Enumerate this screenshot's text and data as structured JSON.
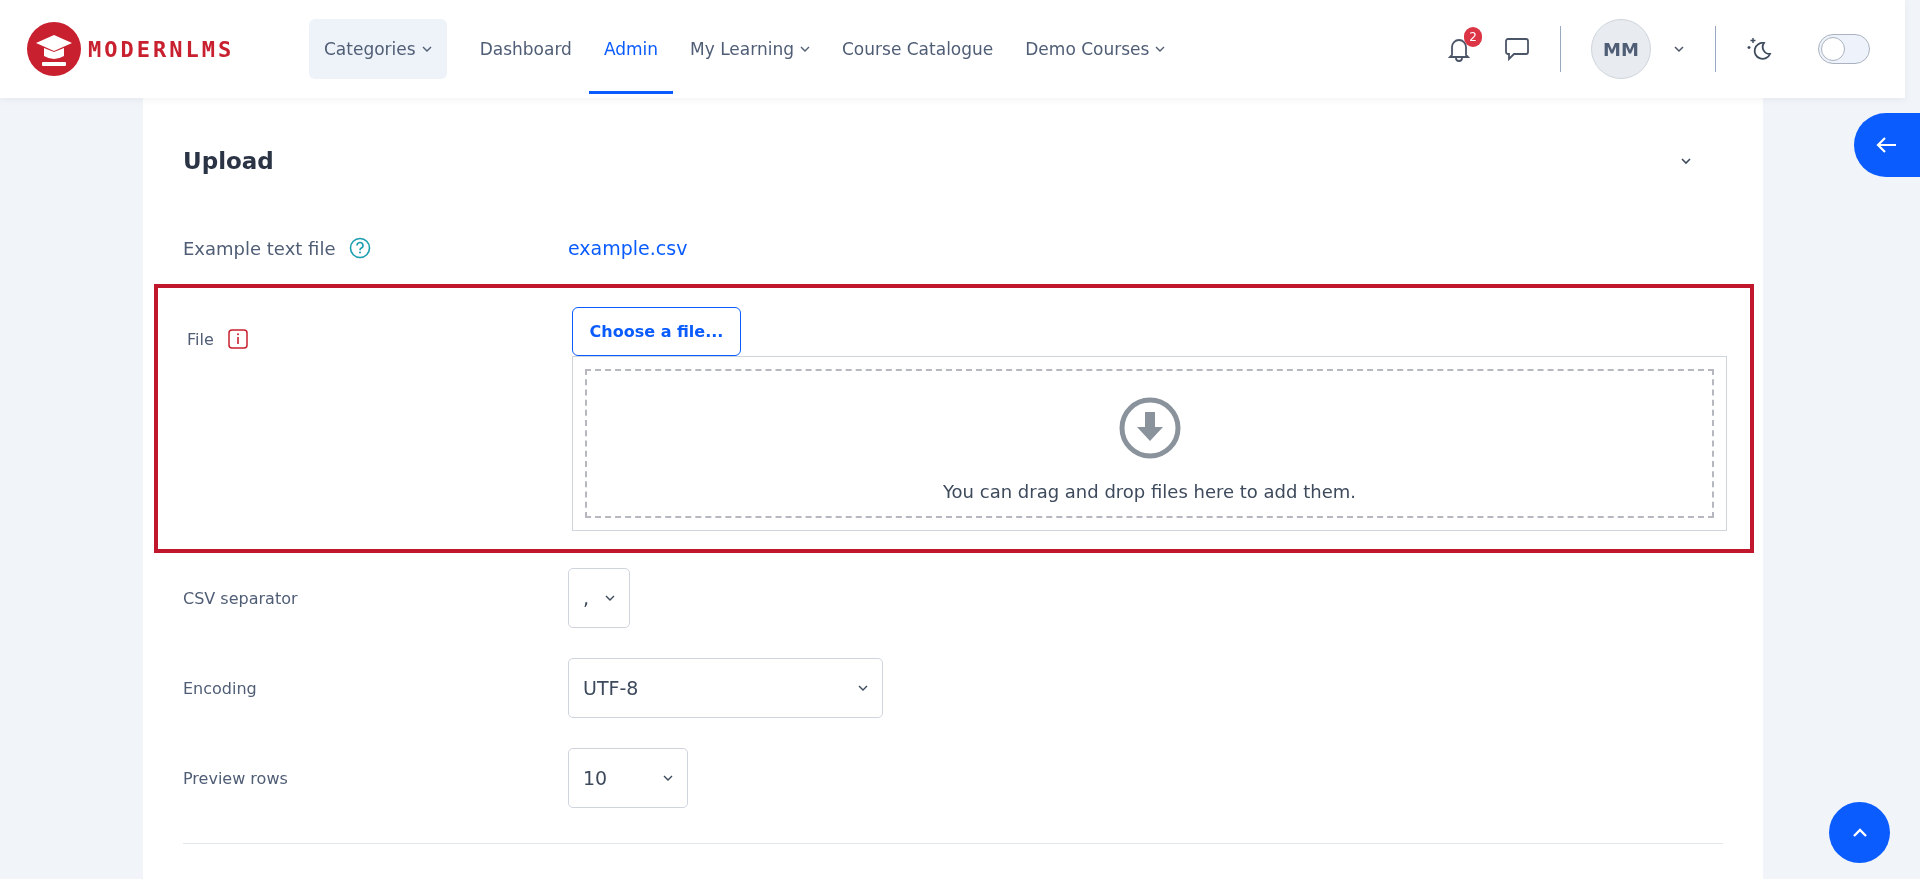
{
  "brand": {
    "name": "MODERNLMS"
  },
  "nav": [
    {
      "label": "Categories",
      "kind": "dropdown",
      "selected": false,
      "boxed": true
    },
    {
      "label": "Dashboard",
      "kind": "link",
      "selected": false,
      "boxed": false
    },
    {
      "label": "Admin",
      "kind": "link",
      "selected": true,
      "boxed": false
    },
    {
      "label": "My Learning",
      "kind": "dropdown",
      "selected": false,
      "boxed": false
    },
    {
      "label": "Course Catalogue",
      "kind": "link",
      "selected": false,
      "boxed": false
    },
    {
      "label": "Demo Courses",
      "kind": "dropdown",
      "selected": false,
      "boxed": false
    }
  ],
  "notifications": {
    "count": "2"
  },
  "user": {
    "initials": "MM"
  },
  "dark_mode": {
    "on": false
  },
  "section": {
    "title": "Upload",
    "expanded": true
  },
  "example": {
    "label": "Example text file",
    "link": "example.csv"
  },
  "file_field": {
    "label": "File",
    "required": true,
    "button": "Choose a file...",
    "drop_hint": "You can drag and drop files here to add them."
  },
  "selects": [
    {
      "label": "CSV separator",
      "value": ","
    },
    {
      "label": "Encoding",
      "value": "UTF-8"
    },
    {
      "label": "Preview rows",
      "value": "10"
    }
  ]
}
